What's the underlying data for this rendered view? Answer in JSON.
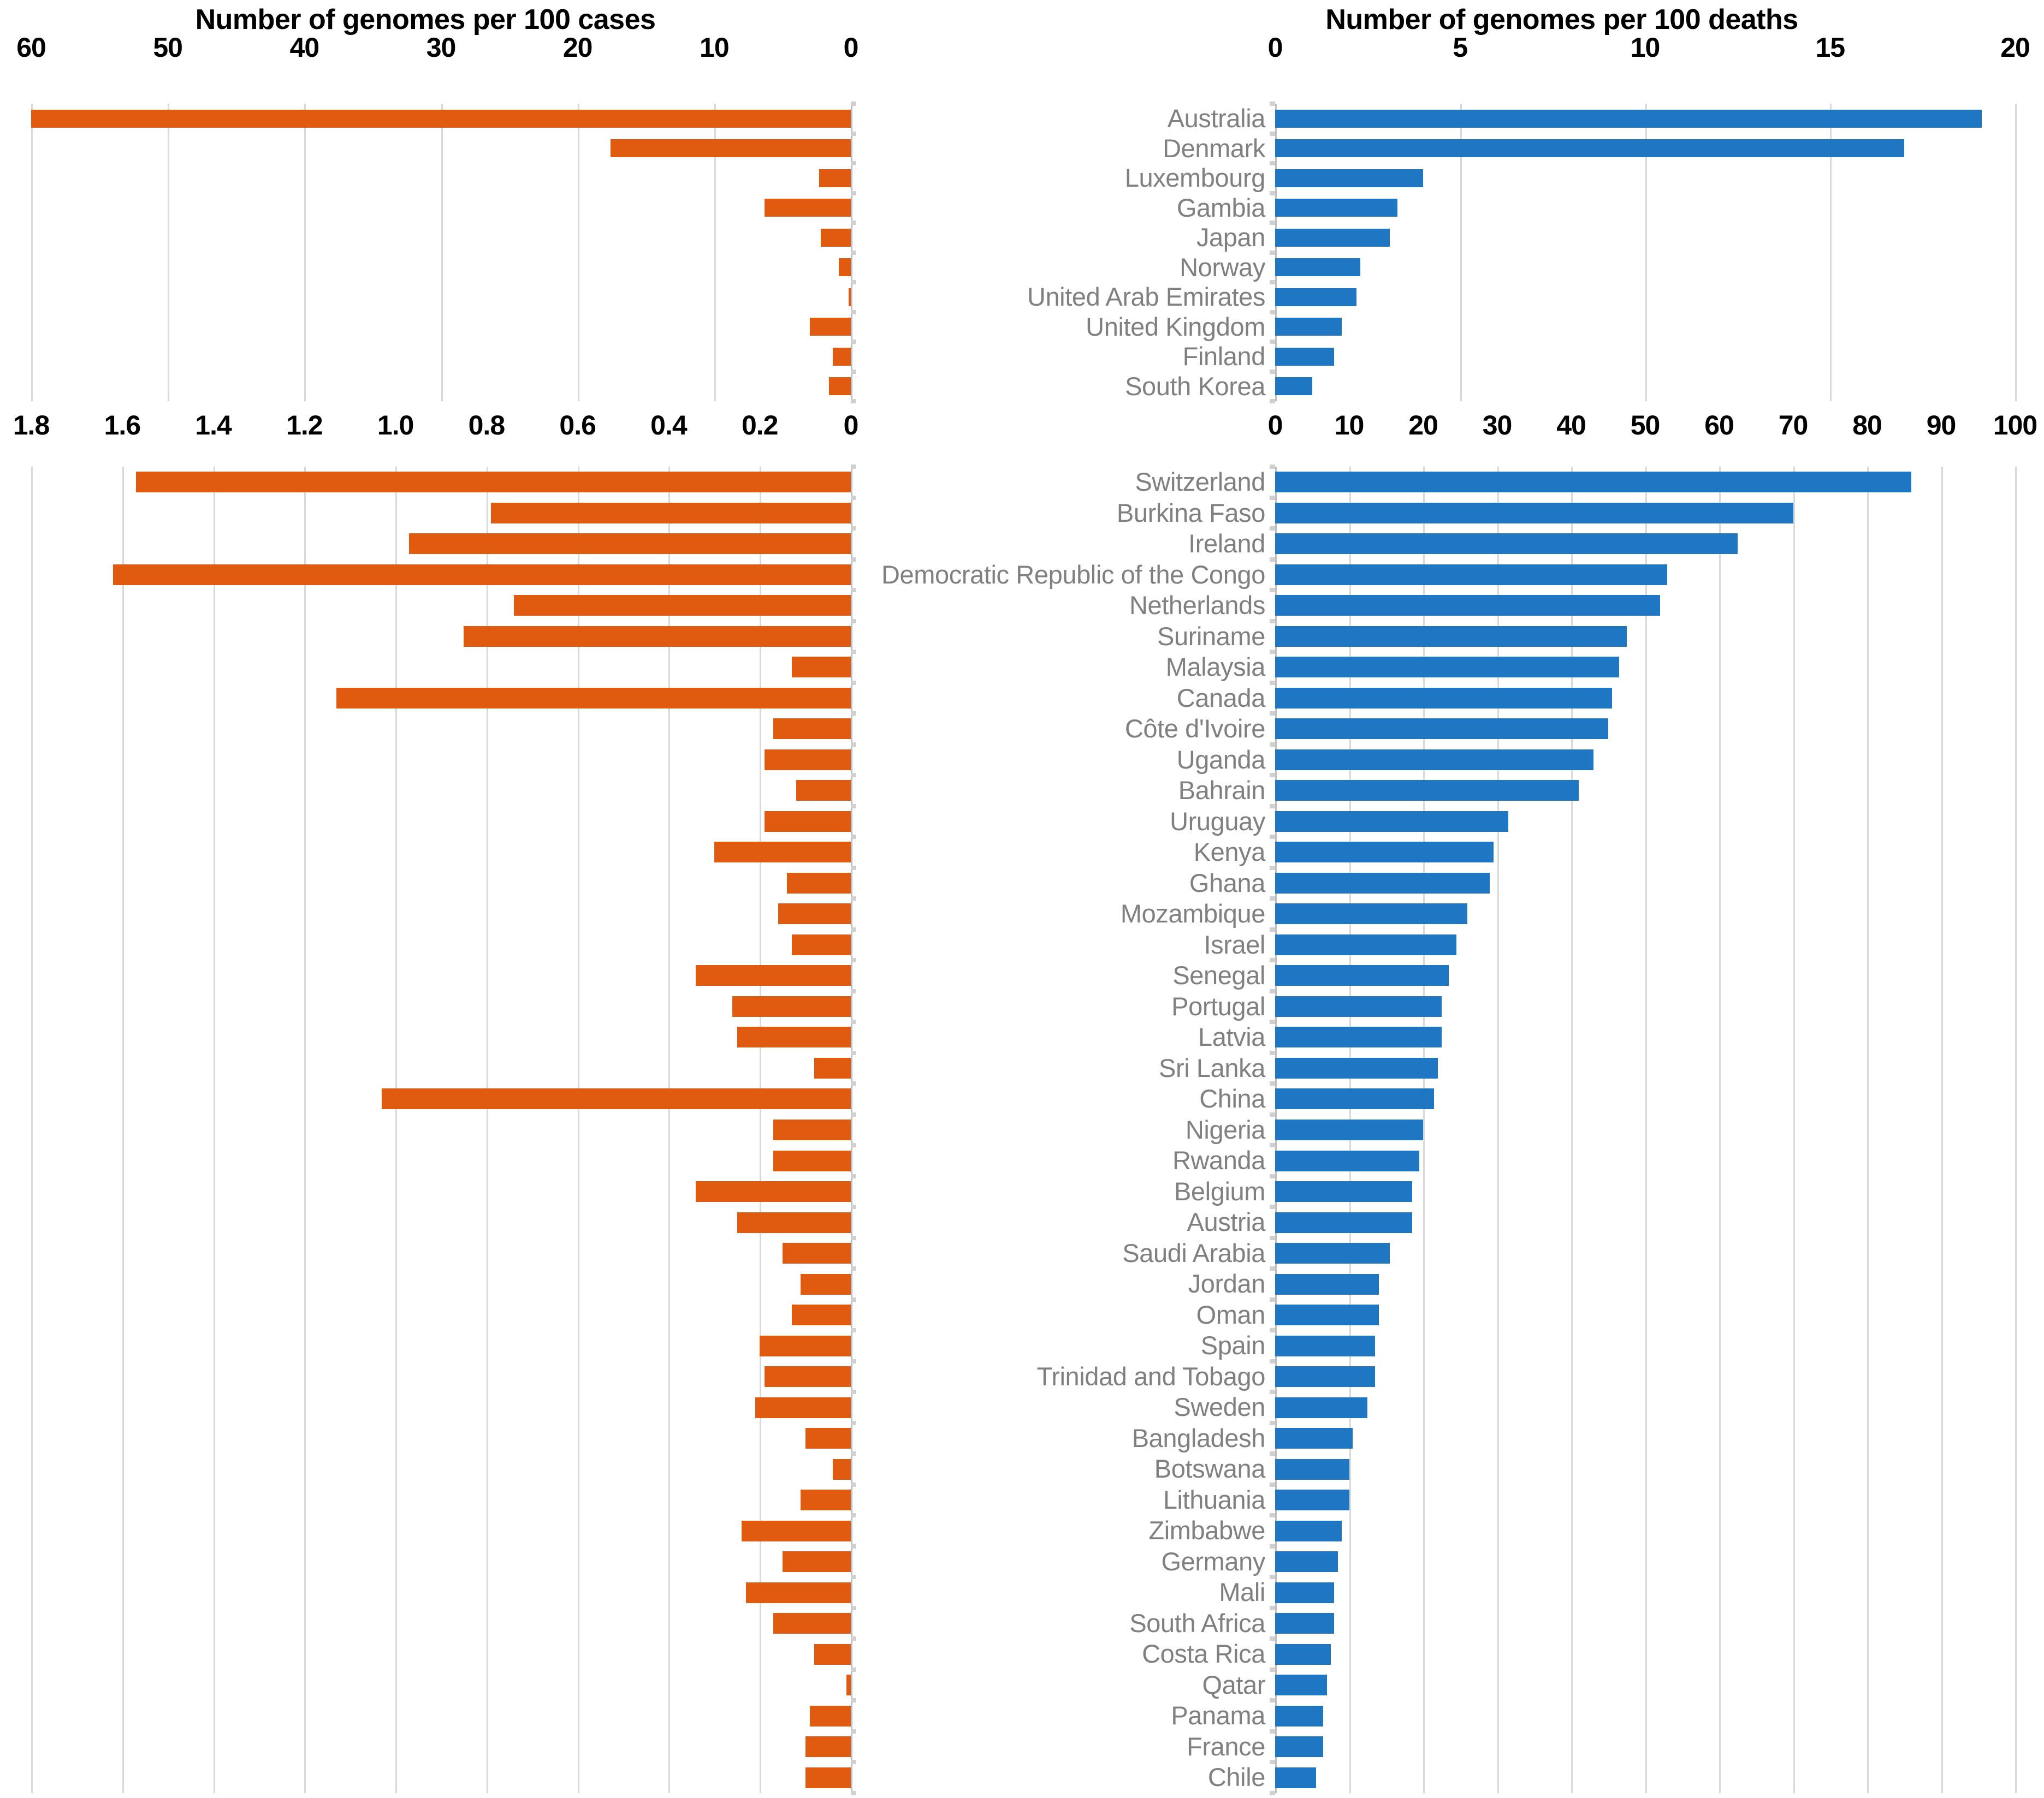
{
  "panels": {
    "top_left": {
      "title": "Number of genomes per 100 cases",
      "ticks": [
        "60",
        "50",
        "40",
        "30",
        "20",
        "10",
        "0"
      ]
    },
    "top_right": {
      "title": "Number of genomes per 100 deaths",
      "ticks": [
        "0",
        "5",
        "10",
        "15",
        "20"
      ]
    },
    "bottom_left": {
      "ticks": [
        "1.8",
        "1.6",
        "1.4",
        "1.2",
        "1.0",
        "0.8",
        "0.6",
        "0.4",
        "0.2",
        "0"
      ]
    },
    "bottom_right": {
      "ticks": [
        "0",
        "10",
        "20",
        "30",
        "40",
        "50",
        "60",
        "70",
        "80",
        "90",
        "100"
      ]
    }
  },
  "colors": {
    "cases_bar": "#E05B10",
    "deaths_bar": "#1F77C4",
    "gridline": "#d9d9d9",
    "label_text": "#808080",
    "axis_text": "#000000"
  },
  "chart_data": [
    {
      "type": "bar",
      "id": "top-cases",
      "title": "Number of genomes per 100 cases",
      "orientation": "horizontal-reversed",
      "xlabel": "",
      "ylabel": "",
      "xlim": [
        0,
        60
      ],
      "grid": true,
      "categories": [
        "Australia",
        "Denmark",
        "Luxembourg",
        "Gambia",
        "Japan",
        "Norway",
        "United Arab Emirates",
        "United Kingdom",
        "Finland",
        "South Korea"
      ],
      "values": [
        60.0,
        17.6,
        2.3,
        6.3,
        2.2,
        0.9,
        0.15,
        3.0,
        1.3,
        1.6
      ]
    },
    {
      "type": "bar",
      "id": "top-deaths",
      "title": "Number of genomes per 100 deaths",
      "orientation": "horizontal",
      "xlabel": "",
      "ylabel": "",
      "xlim": [
        0,
        20
      ],
      "grid": true,
      "categories": [
        "Australia",
        "Denmark",
        "Luxembourg",
        "Gambia",
        "Japan",
        "Norway",
        "United Arab Emirates",
        "United Kingdom",
        "Finland",
        "South Korea"
      ],
      "values": [
        19.1,
        17.0,
        4.0,
        3.3,
        3.1,
        2.3,
        2.2,
        1.8,
        1.6,
        1.0
      ]
    },
    {
      "type": "bar",
      "id": "bottom-cases",
      "title": "Number of genomes per 100 cases",
      "orientation": "horizontal-reversed",
      "xlabel": "",
      "ylabel": "",
      "xlim": [
        0,
        1.8
      ],
      "grid": true,
      "categories": [
        "Switzerland",
        "Burkina Faso",
        "Ireland",
        "Democratic Republic of the Congo",
        "Netherlands",
        "Suriname",
        "Malaysia",
        "Canada",
        "Côte d'Ivoire",
        "Uganda",
        "Bahrain",
        "Uruguay",
        "Kenya",
        "Ghana",
        "Mozambique",
        "Israel",
        "Senegal",
        "Portugal",
        "Latvia",
        "Sri Lanka",
        "China",
        "Nigeria",
        "Rwanda",
        "Belgium",
        "Austria",
        "Saudi Arabia",
        "Jordan",
        "Oman",
        "Spain",
        "Trinidad and Tobago",
        "Sweden",
        "Bangladesh",
        "Botswana",
        "Lithuania",
        "Zimbabwe",
        "Germany",
        "Mali",
        "South Africa",
        "Costa Rica",
        "Qatar",
        "Panama",
        "France",
        "Chile"
      ],
      "values": [
        1.57,
        0.79,
        0.97,
        1.62,
        0.74,
        0.85,
        0.13,
        1.13,
        0.17,
        0.19,
        0.12,
        0.19,
        0.3,
        0.14,
        0.16,
        0.13,
        0.34,
        0.26,
        0.25,
        0.08,
        1.03,
        0.17,
        0.17,
        0.34,
        0.25,
        0.15,
        0.11,
        0.13,
        0.2,
        0.19,
        0.21,
        0.1,
        0.04,
        0.11,
        0.24,
        0.15,
        0.23,
        0.17,
        0.08,
        0.01,
        0.09,
        0.1,
        0.1
      ]
    },
    {
      "type": "bar",
      "id": "bottom-deaths",
      "title": "Number of genomes per 100 deaths",
      "orientation": "horizontal",
      "xlabel": "",
      "ylabel": "",
      "xlim": [
        0,
        100
      ],
      "grid": true,
      "categories": [
        "Switzerland",
        "Burkina Faso",
        "Ireland",
        "Democratic Republic of the Congo",
        "Netherlands",
        "Suriname",
        "Malaysia",
        "Canada",
        "Côte d'Ivoire",
        "Uganda",
        "Bahrain",
        "Uruguay",
        "Kenya",
        "Ghana",
        "Mozambique",
        "Israel",
        "Senegal",
        "Portugal",
        "Latvia",
        "Sri Lanka",
        "China",
        "Nigeria",
        "Rwanda",
        "Belgium",
        "Austria",
        "Saudi Arabia",
        "Jordan",
        "Oman",
        "Spain",
        "Trinidad and Tobago",
        "Sweden",
        "Bangladesh",
        "Botswana",
        "Lithuania",
        "Zimbabwe",
        "Germany",
        "Mali",
        "South Africa",
        "Costa Rica",
        "Qatar",
        "Panama",
        "France",
        "Chile"
      ],
      "values": [
        86.0,
        70.0,
        62.5,
        53.0,
        52.0,
        47.5,
        46.5,
        45.5,
        45.0,
        43.0,
        41.0,
        31.5,
        29.5,
        29.0,
        26.0,
        24.5,
        23.5,
        22.5,
        22.5,
        22.0,
        21.5,
        20.0,
        19.5,
        18.5,
        18.5,
        15.5,
        14.0,
        14.0,
        13.5,
        13.5,
        12.5,
        10.5,
        10.0,
        10.0,
        9.0,
        8.5,
        8.0,
        8.0,
        7.5,
        7.0,
        6.5,
        6.5,
        5.5
      ]
    }
  ],
  "country_labels_top": [
    "Australia",
    "Denmark",
    "Luxembourg",
    "Gambia",
    "Japan",
    "Norway",
    "United Arab Emirates",
    "United Kingdom",
    "Finland",
    "South Korea"
  ],
  "country_labels_bottom": [
    "Switzerland",
    "Burkina Faso",
    "Ireland",
    "Democratic Republic of the Congo",
    "Netherlands",
    "Suriname",
    "Malaysia",
    "Canada",
    "Côte d'Ivoire",
    "Uganda",
    "Bahrain",
    "Uruguay",
    "Kenya",
    "Ghana",
    "Mozambique",
    "Israel",
    "Senegal",
    "Portugal",
    "Latvia",
    "Sri Lanka",
    "China",
    "Nigeria",
    "Rwanda",
    "Belgium",
    "Austria",
    "Saudi Arabia",
    "Jordan",
    "Oman",
    "Spain",
    "Trinidad and Tobago",
    "Sweden",
    "Bangladesh",
    "Botswana",
    "Lithuania",
    "Zimbabwe",
    "Germany",
    "Mali",
    "South Africa",
    "Costa Rica",
    "Qatar",
    "Panama",
    "France",
    "Chile"
  ]
}
